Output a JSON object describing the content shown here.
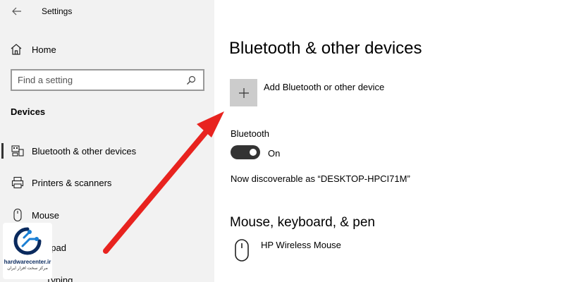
{
  "app": {
    "title": "Settings"
  },
  "sidebar": {
    "home_label": "Home",
    "search_placeholder": "Find a setting",
    "section_heading": "Devices",
    "items": [
      {
        "label": "Bluetooth & other devices",
        "icon": "bluetooth-devices-icon",
        "selected": true
      },
      {
        "label": "Printers & scanners",
        "icon": "printer-icon"
      },
      {
        "label": "Mouse",
        "icon": "mouse-icon"
      },
      {
        "label": "hpad",
        "icon": "touchpad-icon"
      },
      {
        "label": "Typing",
        "icon": "keyboard-icon"
      }
    ]
  },
  "main": {
    "page_title": "Bluetooth & other devices",
    "add_device_label": "Add Bluetooth or other device",
    "bluetooth_label": "Bluetooth",
    "toggle_state": "On",
    "discoverable_text": "Now discoverable as “DESKTOP-HPCI71M”",
    "section_heading": "Mouse, keyboard, & pen",
    "devices": [
      {
        "name": "HP Wireless Mouse",
        "icon": "mouse-icon"
      }
    ]
  },
  "watermark": {
    "site": "hardwarecenter.ir",
    "tagline": "مرکز سخت افزار ایران"
  },
  "colors": {
    "sidebar_bg": "#f2f2f2",
    "toggle_on": "#333333",
    "add_button_bg": "#cccccc",
    "arrow": "#e8231f"
  }
}
